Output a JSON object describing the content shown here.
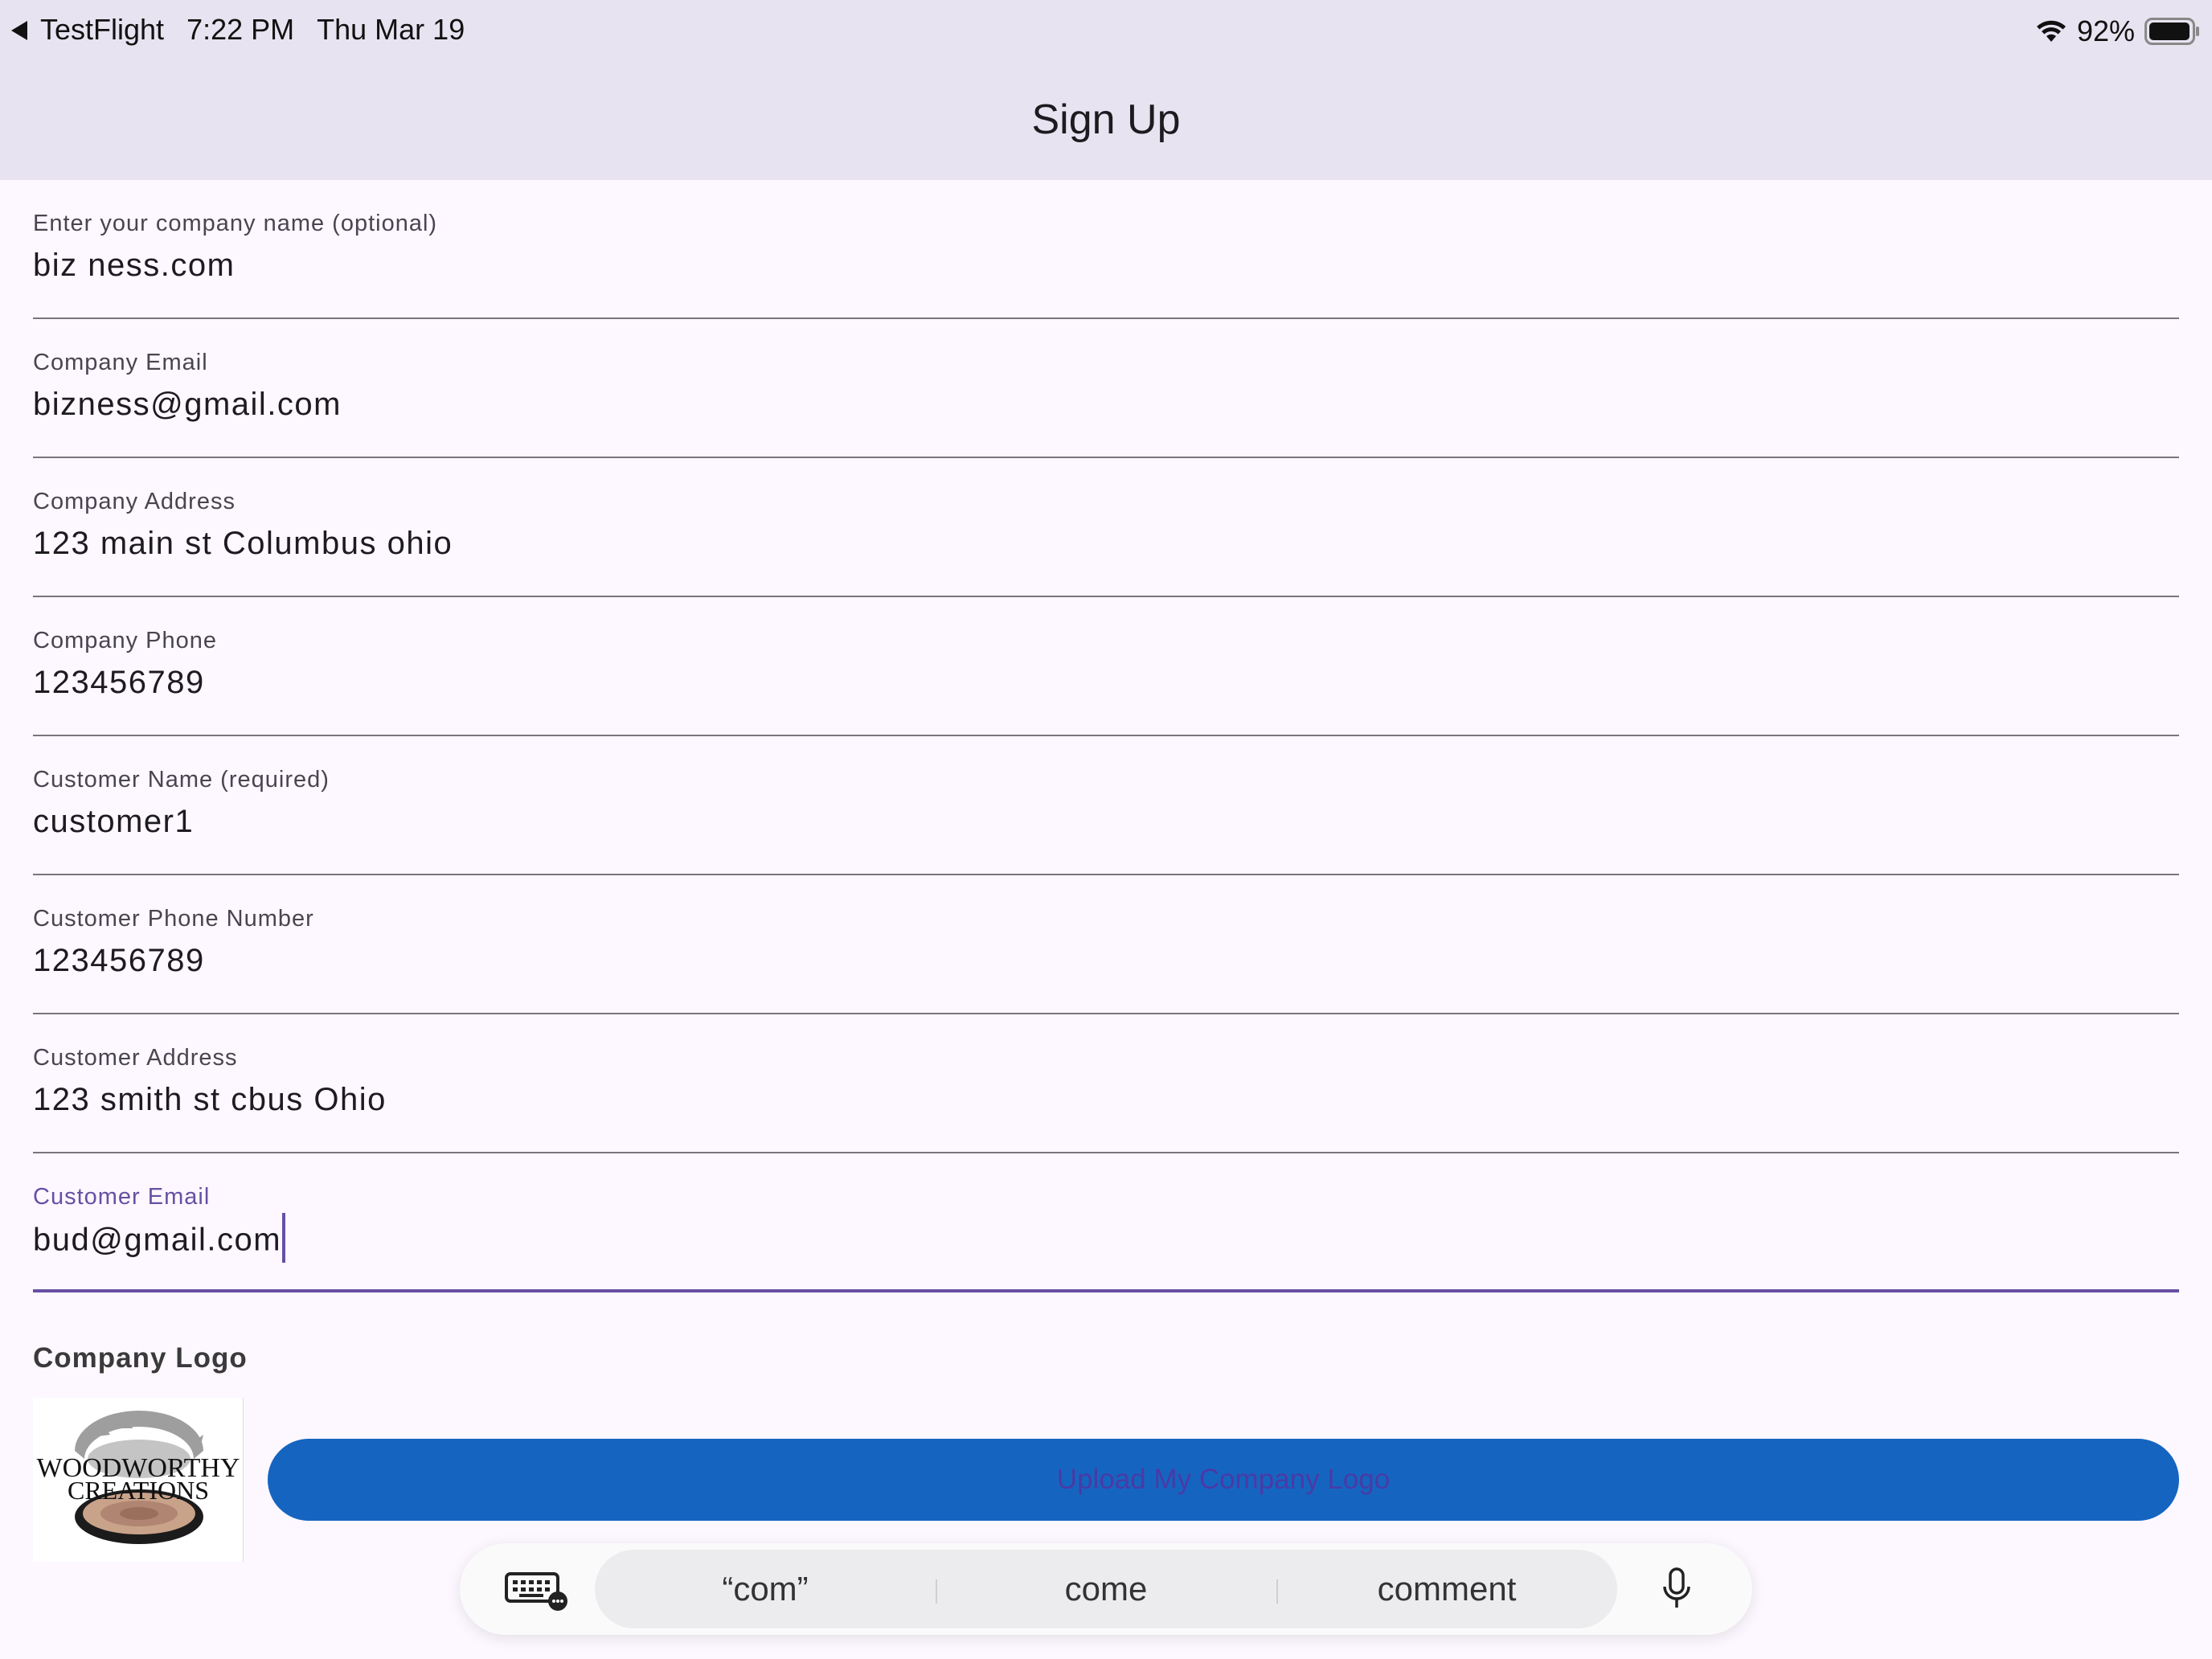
{
  "status_bar": {
    "app": "TestFlight",
    "time": "7:22 PM",
    "date": "Thu Mar 19",
    "battery": "92%",
    "battery_level": 0.92
  },
  "header": {
    "title": "Sign Up"
  },
  "form": {
    "fields": [
      {
        "label": "Enter your company name (optional)",
        "value": "biz ness.com"
      },
      {
        "label": "Company Email",
        "value": "bizness@gmail.com"
      },
      {
        "label": "Company Address",
        "value": "123 main st Columbus ohio"
      },
      {
        "label": "Company Phone",
        "value": "123456789"
      },
      {
        "label": "Customer Name (required)",
        "value": "customer1"
      },
      {
        "label": "Customer Phone Number",
        "value": "123456789"
      },
      {
        "label": "Customer Address",
        "value": "123 smith st cbus  Ohio"
      },
      {
        "label": "Customer Email",
        "value": "bud@gmail.com",
        "focused": true
      }
    ]
  },
  "logo_section": {
    "title": "Company Logo",
    "logo_text_line1": "WOODWORTHY",
    "logo_text_line2": "CREATIONS",
    "upload_label": "Upload My Company Logo"
  },
  "keyboard_bar": {
    "suggestions": [
      "“com”",
      "come",
      "comment"
    ]
  },
  "colors": {
    "app_bar_bg": "#e8e3f0",
    "page_bg": "#fdf7ff",
    "focus_accent": "#6750a4",
    "button_bg": "#1565c0"
  }
}
